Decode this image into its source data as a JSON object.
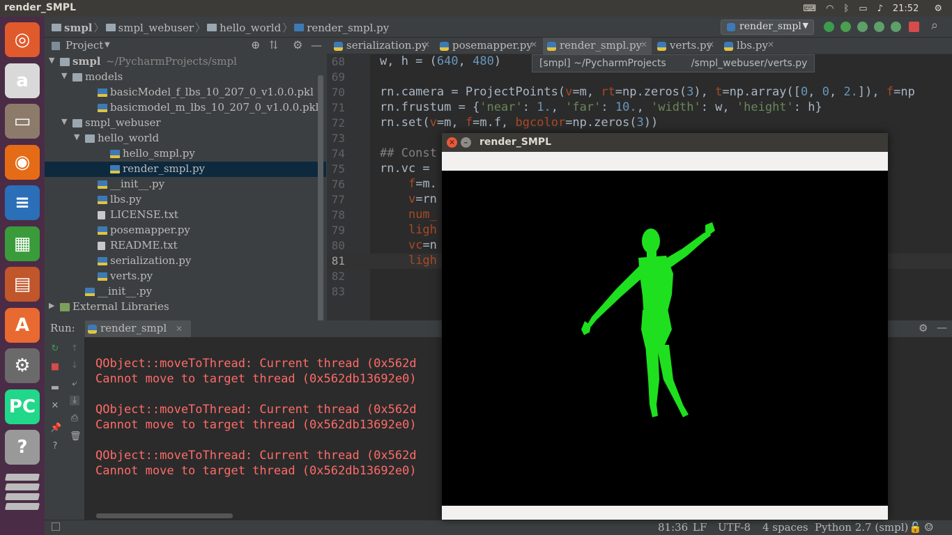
{
  "topbar": {
    "window_title": "render_SMPL",
    "clock": "21:52"
  },
  "launcher": {
    "items": [
      {
        "name": "ubuntu-dash",
        "glyph": "◎",
        "color": "#e05a2b"
      },
      {
        "name": "amazon",
        "glyph": "a",
        "color": "#d9d9d9"
      },
      {
        "name": "files",
        "glyph": "▭",
        "color": "#8c7b6b"
      },
      {
        "name": "firefox",
        "glyph": "◉",
        "color": "#e56b17"
      },
      {
        "name": "writer",
        "glyph": "≡",
        "color": "#2a6fb8"
      },
      {
        "name": "calc",
        "glyph": "▦",
        "color": "#3a9b3a"
      },
      {
        "name": "impress",
        "glyph": "▤",
        "color": "#c0562a"
      },
      {
        "name": "software",
        "glyph": "A",
        "color": "#e86a30"
      },
      {
        "name": "settings",
        "glyph": "⚙",
        "color": "#6a6a6a"
      },
      {
        "name": "pycharm",
        "glyph": "PC",
        "color": "#21d789"
      },
      {
        "name": "help",
        "glyph": "?",
        "color": "#999"
      }
    ]
  },
  "breadcrumb": [
    "smpl",
    "smpl_webuser",
    "hello_world",
    "render_smpl.py"
  ],
  "run_config": "render_smpl",
  "project_panel": {
    "title": "Project",
    "tree": [
      {
        "label": "smpl",
        "extra": "~/PycharmProjects/smpl",
        "indent": 0,
        "arrow": "▼",
        "kind": "folder",
        "bold": true
      },
      {
        "label": "models",
        "indent": 1,
        "arrow": "▼",
        "kind": "folder"
      },
      {
        "label": "basicModel_f_lbs_10_207_0_v1.0.0.pkl",
        "indent": 3,
        "kind": "py"
      },
      {
        "label": "basicmodel_m_lbs_10_207_0_v1.0.0.pkl",
        "indent": 3,
        "kind": "py"
      },
      {
        "label": "smpl_webuser",
        "indent": 1,
        "arrow": "▼",
        "kind": "folder"
      },
      {
        "label": "hello_world",
        "indent": 2,
        "arrow": "▼",
        "kind": "folder"
      },
      {
        "label": "hello_smpl.py",
        "indent": 4,
        "kind": "py"
      },
      {
        "label": "render_smpl.py",
        "indent": 4,
        "kind": "py",
        "selected": true
      },
      {
        "label": "__init__.py",
        "indent": 3,
        "kind": "py"
      },
      {
        "label": "lbs.py",
        "indent": 3,
        "kind": "py"
      },
      {
        "label": "LICENSE.txt",
        "indent": 3,
        "kind": "txt"
      },
      {
        "label": "posemapper.py",
        "indent": 3,
        "kind": "py"
      },
      {
        "label": "README.txt",
        "indent": 3,
        "kind": "txt"
      },
      {
        "label": "serialization.py",
        "indent": 3,
        "kind": "py"
      },
      {
        "label": "verts.py",
        "indent": 3,
        "kind": "py"
      },
      {
        "label": "__init__.py",
        "indent": 2,
        "kind": "py"
      },
      {
        "label": "External Libraries",
        "indent": 0,
        "arrow": "▶",
        "kind": "lib"
      }
    ]
  },
  "tabs": [
    "serialization.py",
    "posemapper.py",
    "render_smpl.py",
    "verts.py",
    "lbs.py"
  ],
  "tooltip": {
    "prefix": "[smpl] ~/PycharmProjects",
    "suffix": "/smpl_webuser/verts.py"
  },
  "code_lines": [
    {
      "n": "68",
      "html": "w, h = (<span class=\"n\">640</span>, <span class=\"n\">480</span>)"
    },
    {
      "n": "69",
      "html": ""
    },
    {
      "n": "70",
      "html": "rn.camera = ProjectPoints(<span class=\"p\">v</span>=m, <span class=\"p\">rt</span>=np.zeros(<span class=\"n\">3</span>), <span class=\"p\">t</span>=np.array([<span class=\"n\">0</span>, <span class=\"n\">0</span>, <span class=\"n\">2.</span>]), <span class=\"p\">f</span>=np"
    },
    {
      "n": "71",
      "html": "rn.frustum = {<span class=\"s\">'near'</span>: <span class=\"n\">1.</span>, <span class=\"s\">'far'</span>: <span class=\"n\">10.</span>, <span class=\"s\">'width'</span>: w, <span class=\"s\">'height'</span>: h}"
    },
    {
      "n": "72",
      "html": "rn.set(<span class=\"p\">v</span>=m, <span class=\"p\">f</span>=m.f, <span class=\"p\">bgcolor</span>=np.zeros(<span class=\"n\">3</span>))"
    },
    {
      "n": "73",
      "html": ""
    },
    {
      "n": "74",
      "html": "<span class=\"c\">## Const</span>"
    },
    {
      "n": "75",
      "html": "rn.vc ="
    },
    {
      "n": "76",
      "html": "    <span class=\"p\">f</span>=m."
    },
    {
      "n": "77",
      "html": "    <span class=\"p\">v</span>=rn"
    },
    {
      "n": "78",
      "html": "    <span class=\"p\">num_</span>"
    },
    {
      "n": "79",
      "html": "    <span class=\"p\">ligh</span>"
    },
    {
      "n": "80",
      "html": "    <span class=\"p\">vc</span>=n"
    },
    {
      "n": "81",
      "html": "    <span class=\"p\">ligh</span>",
      "current": true
    },
    {
      "n": "82",
      "html": ""
    },
    {
      "n": "83",
      "html": ""
    }
  ],
  "run_panel": {
    "label": "Run:",
    "tab": "render_smpl",
    "output": [
      "QObject::moveToThread: Current thread (0x562d",
      "Cannot move to target thread (0x562db13692e0)",
      "",
      "QObject::moveToThread: Current thread (0x562d",
      "Cannot move to target thread (0x562db13692e0)",
      "",
      "QObject::moveToThread: Current thread (0x562d",
      "Cannot move to target thread (0x562db13692e0)"
    ]
  },
  "status_bar": {
    "position": "81:36",
    "line_sep": "LF",
    "encoding": "UTF-8",
    "indent": "4 spaces",
    "interpreter": "Python 2.7 (smpl)"
  },
  "popup": {
    "title": "render_SMPL",
    "figure_color": "#1ee01e"
  }
}
